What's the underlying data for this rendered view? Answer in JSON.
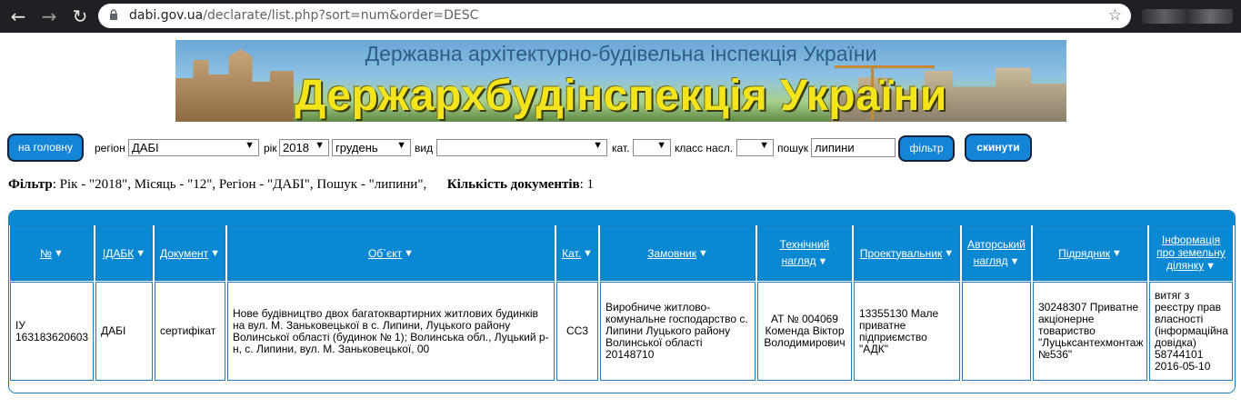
{
  "browser": {
    "url_host": "dabi.gov.ua",
    "url_path": "/declarate/list.php?sort=num&order=DESC",
    "icons": [
      "back-icon",
      "forward-icon",
      "reload-icon",
      "lock-icon",
      "star-icon"
    ]
  },
  "banner": {
    "subtitle": "Державна архітектурно-будівельна інспекція України",
    "title": "Держархбудінспекція України"
  },
  "filters": {
    "home_button": "на головну",
    "region_label": "регіон",
    "region_value": "ДАБІ",
    "year_label": "рік",
    "year_value": "2018",
    "month_value": "грудень",
    "type_label": "вид",
    "type_value": "",
    "cat_label": "кат.",
    "cat_value": "",
    "class_label": "класс насл.",
    "class_value": "",
    "search_label": "пошук",
    "search_value": "липини",
    "filter_button": "фільтр",
    "reset_button": "скинути"
  },
  "summary": {
    "filter_label": "Фільтр",
    "filter_text": ": Рік - \"2018\", Місяць - \"12\", Регіон - \"ДАБІ\", Пошук - \"липини\",",
    "count_label": "Кількість документів",
    "count_text": ": 1"
  },
  "table": {
    "headers": {
      "num": "№",
      "idabk": "ІДАБК",
      "doc": "Документ",
      "object": "Об`єкт",
      "cat": "Кат.",
      "customer": "Замовник",
      "tech1": "Технічний",
      "tech2": "нагляд",
      "designer": "Проектувальник",
      "author1": "Авторський",
      "author2": "нагляд",
      "contractor": "Підрядник",
      "land1": "Інформація",
      "land2": "про земельну",
      "land3": "ділянку"
    },
    "row": {
      "num": "ІУ 163183620603",
      "idabk": "ДАБІ",
      "doc": "сертифікат",
      "object": "Нове будівництво двох багатоквартирних житлових будинків на вул. М. Заньковецької в с. Липини, Луцького району Волинської області (будинок № 1); Волинська обл., Луцький р-н, с. Липини, вул. М. Заньковецької, 00",
      "cat": "СС3",
      "customer": "Виробниче житлово-комунальне господарство с. Липини Луцького району Волинської області 20148710",
      "tech": "АТ № 004069 Коменда Віктор Володимирович",
      "designer": "13355130 Мале приватне підприємство \"АДК\"",
      "author": "",
      "contractor": "30248307 Приватне акціонерне товариство \"Луцьксантехмонтаж №536\"",
      "land": "витяг з реєстру прав власності (інформаційна довідка) 58744101 2016-05-10"
    }
  },
  "colors": {
    "header_blue": "#0a88d2",
    "button_blue": "#1384d6",
    "banner_title": "#f4e41c"
  }
}
